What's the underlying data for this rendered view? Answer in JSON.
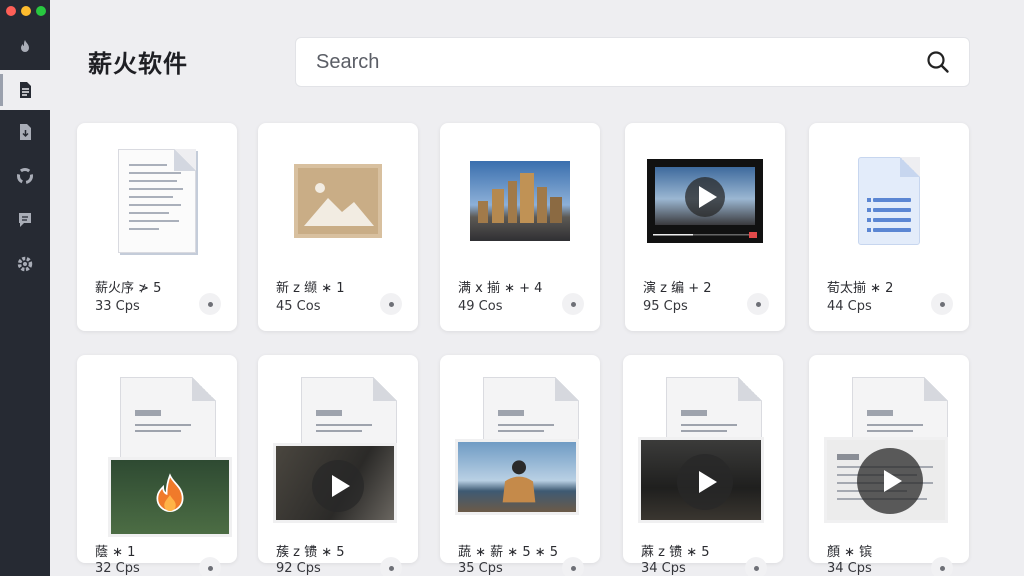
{
  "app": {
    "title": "薪火软件"
  },
  "search": {
    "placeholder": "Search"
  },
  "sidebar": {
    "items": [
      {
        "icon": "flame-icon",
        "active": false
      },
      {
        "icon": "document-icon",
        "active": true
      },
      {
        "icon": "download-doc-icon",
        "active": false
      },
      {
        "icon": "recycle-icon",
        "active": false
      },
      {
        "icon": "chat-icon",
        "active": false
      },
      {
        "icon": "gear-icon",
        "active": false
      }
    ]
  },
  "files": [
    {
      "name": "薪火序 ≯ 5",
      "meta": "33 Cps",
      "thumb": "document"
    },
    {
      "name": "新 z 缬 ∗ 1",
      "meta": "45 Cos",
      "thumb": "image"
    },
    {
      "name": "满 x 揃 ∗ + 4",
      "meta": "49 Cos",
      "thumb": "city-photo"
    },
    {
      "name": "演 z 编 + 2",
      "meta": "95 Cps",
      "thumb": "video"
    },
    {
      "name": "荀太揃 ∗ 2",
      "meta": "44 Cps",
      "thumb": "text-document"
    },
    {
      "name": "蔭 ∗ 1",
      "meta": "32 Cps",
      "thumb": "doc-flame"
    },
    {
      "name": "蔟 z 镄 ∗ 5",
      "meta": "92 Cps",
      "thumb": "doc-video"
    },
    {
      "name": "蔬 ∗ 薪 ∗ 5 ∗ 5",
      "meta": "35 Cps",
      "thumb": "doc-photo"
    },
    {
      "name": "蔴 z 镄 ∗ 5",
      "meta": "34 Cps",
      "thumb": "doc-video"
    },
    {
      "name": "顏 ∗ 镔",
      "meta": "34 Cps",
      "thumb": "doc-video"
    }
  ],
  "colors": {
    "sidebar": "#262a33",
    "background": "#eeeef1",
    "card": "#ffffff"
  }
}
